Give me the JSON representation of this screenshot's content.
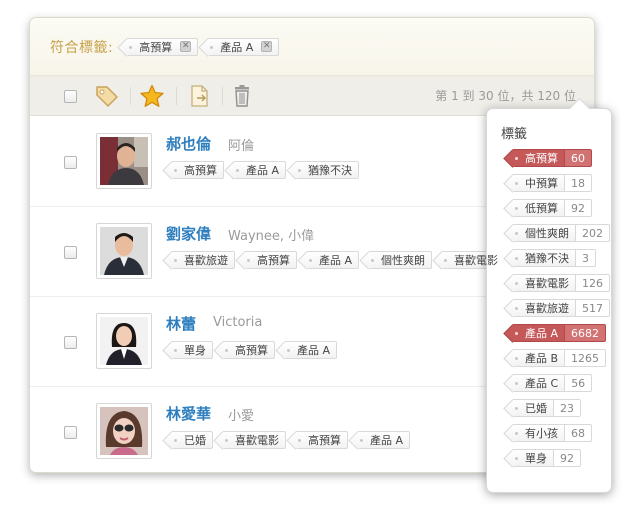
{
  "filter": {
    "label": "符合標籤:",
    "active_tags": [
      "高預算",
      "產品 A"
    ]
  },
  "toolbar": {
    "paging": "第 1 到 30 位，共 120 位"
  },
  "contacts": [
    {
      "name": "郝也倫",
      "alias": "阿倫",
      "tags": [
        "高預算",
        "產品 A",
        "猶豫不決"
      ]
    },
    {
      "name": "劉家偉",
      "alias": "Waynee, 小偉",
      "tags": [
        "喜歡旅遊",
        "高預算",
        "產品 A",
        "個性爽朗",
        "喜歡電影"
      ]
    },
    {
      "name": "林蕾",
      "alias": "Victoria",
      "tags": [
        "單身",
        "高預算",
        "產品 A"
      ]
    },
    {
      "name": "林愛華",
      "alias": "小愛",
      "tags": [
        "已婚",
        "喜歡電影",
        "高預算",
        "產品 A"
      ]
    }
  ],
  "tag_panel": {
    "title": "標籤",
    "tags": [
      {
        "label": "高預算",
        "count": "60",
        "active": true
      },
      {
        "label": "中預算",
        "count": "18",
        "active": false
      },
      {
        "label": "低預算",
        "count": "92",
        "active": false
      },
      {
        "label": "個性爽朗",
        "count": "202",
        "active": false
      },
      {
        "label": "猶豫不決",
        "count": "3",
        "active": false
      },
      {
        "label": "喜歡電影",
        "count": "126",
        "active": false
      },
      {
        "label": "喜歡旅遊",
        "count": "517",
        "active": false
      },
      {
        "label": "產品 A",
        "count": "6682",
        "active": true
      },
      {
        "label": "產品 B",
        "count": "1265",
        "active": false
      },
      {
        "label": "產品 C",
        "count": "56",
        "active": false
      },
      {
        "label": "已婚",
        "count": "23",
        "active": false
      },
      {
        "label": "有小孩",
        "count": "68",
        "active": false
      },
      {
        "label": "單身",
        "count": "92",
        "active": false
      }
    ]
  },
  "colors": {
    "accent_gold": "#c7a24b",
    "name_blue": "#2f7fbf",
    "active_tag_red": "#c55858"
  },
  "icons": [
    "tag-icon",
    "star-icon",
    "export-document-icon",
    "trash-icon",
    "remove-tag-icon"
  ]
}
